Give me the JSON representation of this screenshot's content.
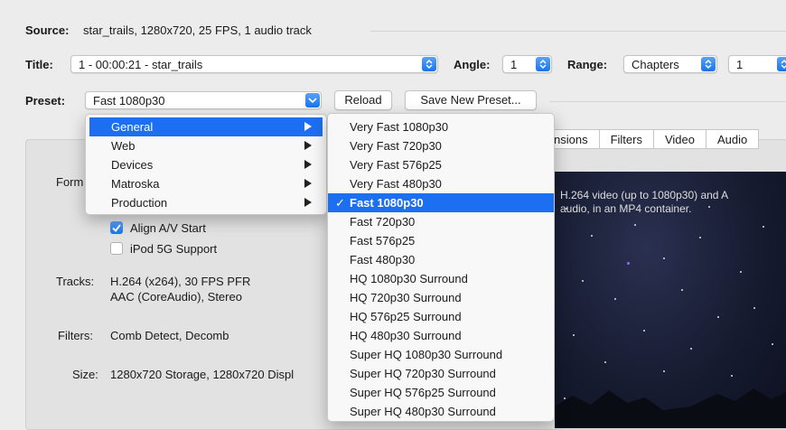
{
  "source": {
    "label": "Source:",
    "value": "star_trails, 1280x720, 25 FPS, 1 audio track"
  },
  "title_row": {
    "title_label": "Title:",
    "title_value": "1 - 00:00:21 - star_trails",
    "angle_label": "Angle:",
    "angle_value": "1",
    "range_label": "Range:",
    "range_value": "Chapters",
    "range_start": "1"
  },
  "preset_row": {
    "label": "Preset:",
    "value": "Fast 1080p30",
    "reload_label": "Reload",
    "save_label": "Save New Preset..."
  },
  "tabs": [
    "nsions",
    "Filters",
    "Video",
    "Audio"
  ],
  "summary": {
    "format_label": "Form",
    "align_av": {
      "label": "Align A/V Start",
      "checked": true
    },
    "ipod": {
      "label": "iPod 5G Support",
      "checked": false
    },
    "tracks_label": "Tracks:",
    "tracks_line1": "H.264 (x264), 30 FPS PFR",
    "tracks_line2": "AAC (CoreAudio), Stereo",
    "filters_label": "Filters:",
    "filters_value": "Comb Detect, Decomb",
    "size_label": "Size:",
    "size_value": "1280x720 Storage, 1280x720 Displ"
  },
  "preview": {
    "description": "H.264 video (up to 1080p30) and A\naudio, in an MP4 container."
  },
  "category_menu": {
    "items": [
      {
        "label": "General",
        "selected": true
      },
      {
        "label": "Web",
        "selected": false
      },
      {
        "label": "Devices",
        "selected": false
      },
      {
        "label": "Matroska",
        "selected": false
      },
      {
        "label": "Production",
        "selected": false
      }
    ]
  },
  "preset_menu": {
    "items": [
      {
        "label": "Very Fast 1080p30",
        "selected": false
      },
      {
        "label": "Very Fast 720p30",
        "selected": false
      },
      {
        "label": "Very Fast 576p25",
        "selected": false
      },
      {
        "label": "Very Fast 480p30",
        "selected": false
      },
      {
        "label": "Fast 1080p30",
        "selected": true
      },
      {
        "label": "Fast 720p30",
        "selected": false
      },
      {
        "label": "Fast 576p25",
        "selected": false
      },
      {
        "label": "Fast 480p30",
        "selected": false
      },
      {
        "label": "HQ 1080p30 Surround",
        "selected": false
      },
      {
        "label": "HQ 720p30 Surround",
        "selected": false
      },
      {
        "label": "HQ 576p25 Surround",
        "selected": false
      },
      {
        "label": "HQ 480p30 Surround",
        "selected": false
      },
      {
        "label": "Super HQ 1080p30 Surround",
        "selected": false
      },
      {
        "label": "Super HQ 720p30 Surround",
        "selected": false
      },
      {
        "label": "Super HQ 576p25 Surround",
        "selected": false
      },
      {
        "label": "Super HQ 480p30 Surround",
        "selected": false
      }
    ]
  },
  "colors": {
    "accent": "#1d6ff2",
    "background": "#ececec"
  }
}
